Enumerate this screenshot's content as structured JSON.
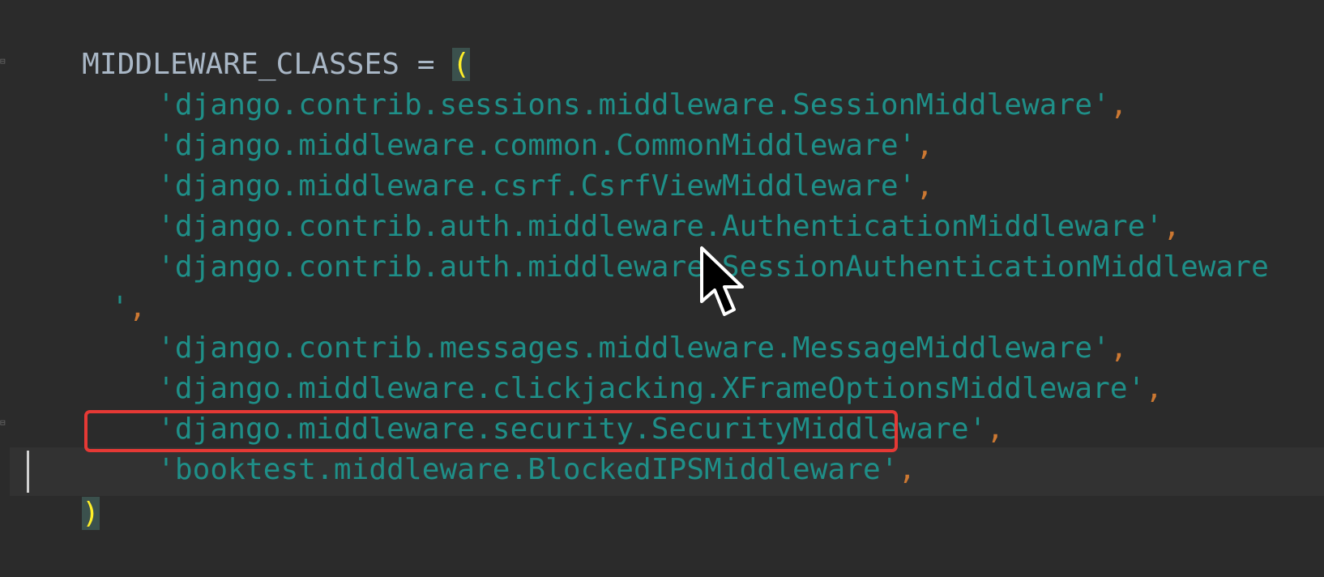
{
  "editor": {
    "assignment": {
      "name": "MIDDLEWARE_CLASSES",
      "operator": "=",
      "open_paren": "("
    },
    "entries": [
      {
        "string": "'django.contrib.sessions.middleware.SessionMiddleware'",
        "comma": ","
      },
      {
        "string": "'django.middleware.common.CommonMiddleware'",
        "comma": ","
      },
      {
        "string": "'django.middleware.csrf.CsrfViewMiddleware'",
        "comma": ","
      },
      {
        "string": "'django.contrib.auth.middleware.AuthenticationMiddleware'",
        "comma": ","
      },
      {
        "string": "'django.contrib.auth.middleware.SessionAuthenticationMiddleware",
        "comma": ""
      },
      {
        "string": "'",
        "comma": ","
      },
      {
        "string": "'django.contrib.messages.middleware.MessageMiddleware'",
        "comma": ","
      },
      {
        "string": "'django.middleware.clickjacking.XFrameOptionsMiddleware'",
        "comma": ","
      },
      {
        "string": "'django.middleware.security.SecurityMiddleware'",
        "comma": ","
      },
      {
        "string": "'booktest.middleware.BlockedIPSMiddleware'",
        "comma": ","
      }
    ],
    "close_paren": ")",
    "highlighted_entry_index": 9
  },
  "colors": {
    "background": "#2b2b2b",
    "identifier": "#a9b7c6",
    "string": "#1f8f88",
    "comma": "#cc7832",
    "paren_match": "#ffef28",
    "highlight_box": "#e53935"
  },
  "icons": [
    "fold-marker-icon",
    "mouse-pointer-icon",
    "text-caret"
  ]
}
